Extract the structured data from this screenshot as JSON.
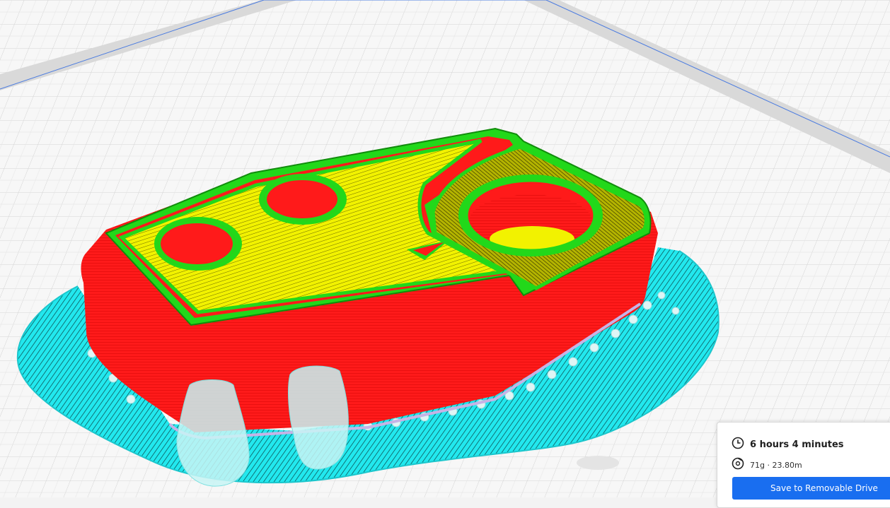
{
  "viewport": {
    "colors": {
      "wall_outer": "#ff1a1a",
      "wall_inner": "#22d81a",
      "infill": "#f2f200",
      "support_skirt": "#22e8ee",
      "support_pillar": "#bff3f3",
      "build_plate": "#f7f7f7",
      "grid_line": "#d2d2d2",
      "plate_border": "#cfcfcf",
      "plate_edge_line": "#4a7be0"
    }
  },
  "print_info": {
    "time_icon": "clock-icon",
    "print_time": "6 hours 4 minutes",
    "material_icon": "spool-icon",
    "material": "71g · 23.80m",
    "save_label": "Save to Removable Drive",
    "accent": "#196ef0"
  }
}
